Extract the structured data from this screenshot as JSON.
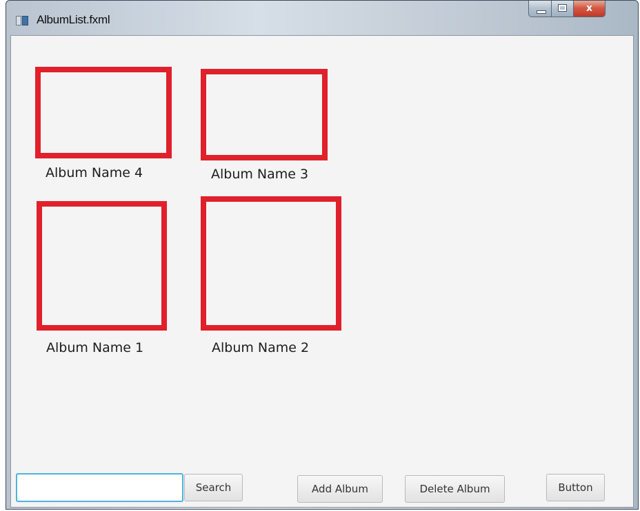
{
  "window": {
    "title": "AlbumList.fxml",
    "close_glyph": "x"
  },
  "albums": [
    {
      "name": "Album Name 4"
    },
    {
      "name": "Album Name 3"
    },
    {
      "name": "Album Name 1"
    },
    {
      "name": "Album Name 2"
    }
  ],
  "toolbar": {
    "search_value": "",
    "search_label": "Search",
    "add_label": "Add Album",
    "delete_label": "Delete Album",
    "button_label": "Button"
  },
  "colors": {
    "thumbnail_border": "#e0202b",
    "focus_ring": "#4db3dc",
    "background": "#f4f4f4"
  }
}
